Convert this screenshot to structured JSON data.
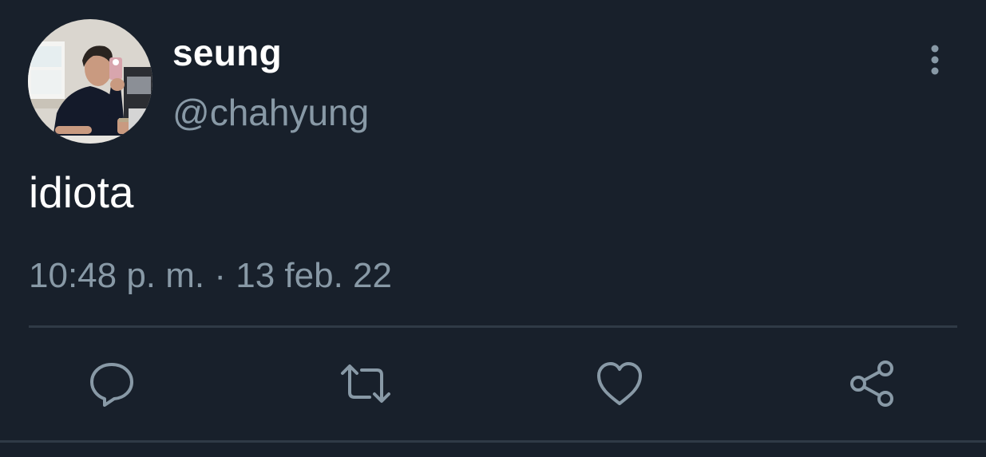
{
  "user": {
    "display_name": "seung",
    "handle": "@chahyung",
    "avatar": "profile-photo"
  },
  "tweet": {
    "text": "idiota",
    "timestamp": "10:48 p. m. · 13 feb. 22"
  },
  "actions": [
    {
      "icon": "reply-icon"
    },
    {
      "icon": "retweet-icon"
    },
    {
      "icon": "like-icon"
    },
    {
      "icon": "share-icon"
    }
  ],
  "more_menu": {
    "icon": "more-vertical-icon"
  },
  "colors": {
    "background": "#18202b",
    "primary_text": "#ffffff",
    "secondary_text": "#8899a6",
    "icon": "#8899a6",
    "divider": "#2f3a46"
  }
}
